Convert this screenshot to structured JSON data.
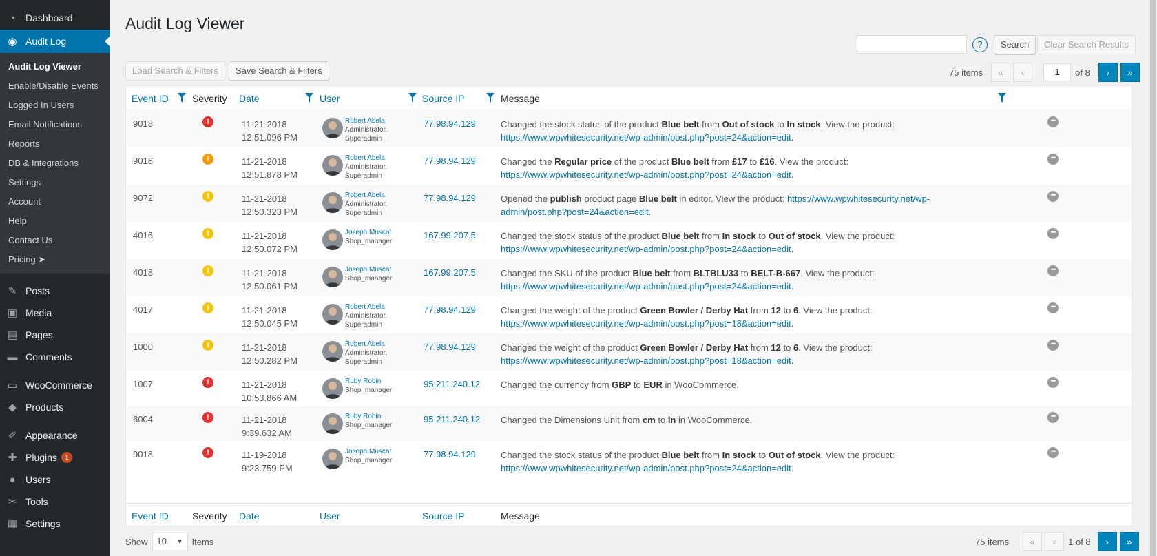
{
  "sidebar": {
    "top": [
      {
        "label": "Dashboard",
        "icon": "dashboard-icon",
        "glyph": "◔"
      },
      {
        "label": "Audit Log",
        "icon": "audit-log-icon",
        "glyph": "◉"
      }
    ],
    "submenu": [
      "Audit Log Viewer",
      "Enable/Disable Events",
      "Logged In Users",
      "Email Notifications",
      "Reports",
      "DB & Integrations",
      "Settings",
      "Account",
      "Help",
      "Contact Us",
      "Pricing ➤"
    ],
    "group1": [
      {
        "label": "Posts",
        "icon": "pin-icon",
        "glyph": "✎"
      },
      {
        "label": "Media",
        "icon": "media-icon",
        "glyph": "▣"
      },
      {
        "label": "Pages",
        "icon": "pages-icon",
        "glyph": "▤"
      },
      {
        "label": "Comments",
        "icon": "comments-icon",
        "glyph": "▬"
      }
    ],
    "group2": [
      {
        "label": "WooCommerce",
        "icon": "woocommerce-icon",
        "glyph": "▭"
      },
      {
        "label": "Products",
        "icon": "products-icon",
        "glyph": "◆"
      }
    ],
    "group3": [
      {
        "label": "Appearance",
        "icon": "appearance-icon",
        "glyph": "✐"
      },
      {
        "label": "Plugins",
        "icon": "plugins-icon",
        "glyph": "✚",
        "badge": "1"
      },
      {
        "label": "Users",
        "icon": "users-icon",
        "glyph": "●"
      },
      {
        "label": "Tools",
        "icon": "tools-icon",
        "glyph": "✂"
      },
      {
        "label": "Settings",
        "icon": "settings-icon",
        "glyph": "▦"
      }
    ]
  },
  "page": {
    "title": "Audit Log Viewer",
    "search_btn": "Search",
    "clear_btn": "Clear Search Results",
    "load_btn": "Load Search & Filters",
    "save_btn": "Save Search & Filters",
    "help": "?"
  },
  "pager_top": {
    "items": "75 items",
    "first": "«",
    "prev": "‹",
    "current": "1",
    "of": "of 8",
    "next": "›",
    "last": "»"
  },
  "pager_bottom": {
    "items": "75 items",
    "first": "«",
    "prev": "‹",
    "of": "1 of 8",
    "next": "›",
    "last": "»"
  },
  "footer": {
    "show": "Show",
    "per_page": "10",
    "items": "Items"
  },
  "columns": {
    "event_id": "Event ID",
    "severity": "Severity",
    "date": "Date",
    "user": "User",
    "source_ip": "Source IP",
    "message": "Message"
  },
  "rows": [
    {
      "id": "9018",
      "sev": "critical",
      "sev_glyph": "!",
      "date1": "11-21-2018",
      "date2": "12:51.096 PM",
      "user": "Robert Abela",
      "role1": "Administrator,",
      "role2": "Superadmin",
      "ip": "77.98.94.129",
      "msg": "Changed the stock status of the product <b>Blue belt</b> from <b>Out of stock</b> to <b>In stock</b>. View the product: <a>https://www.wpwhitesecurity.net/wp-admin/post.php?post=24&amp;action=edit</a>."
    },
    {
      "id": "9016",
      "sev": "high",
      "sev_glyph": "!",
      "date1": "11-21-2018",
      "date2": "12:51.878 PM",
      "user": "Robert Abela",
      "role1": "Administrator,",
      "role2": "Superadmin",
      "ip": "77.98.94.129",
      "msg": "Changed the <b>Regular price</b> of the product <b>Blue belt</b> from <b>£17</b> to <b>£16</b>. View the product: <a>https://www.wpwhitesecurity.net/wp-admin/post.php?post=24&amp;action=edit</a>."
    },
    {
      "id": "9072",
      "sev": "low",
      "sev_glyph": "i",
      "date1": "11-21-2018",
      "date2": "12:50.323 PM",
      "user": "Robert Abela",
      "role1": "Administrator,",
      "role2": "Superadmin",
      "ip": "77.98.94.129",
      "msg": "Opened the <b>publish</b> product page <b>Blue belt</b> in editor. View the product: <a>https://www.wpwhitesecurity.net/wp-admin/post.php?post=24&amp;action=edit</a>."
    },
    {
      "id": "4016",
      "sev": "low",
      "sev_glyph": "i",
      "date1": "11-21-2018",
      "date2": "12:50.072 PM",
      "user": "Joseph Muscat",
      "role1": "Shop_manager",
      "role2": "",
      "ip": "167.99.207.5",
      "msg": "Changed the stock status of the product <b>Blue belt</b> from <b>In stock</b> to <b>Out of stock</b>. View the product: <a>https://www.wpwhitesecurity.net/wp-admin/post.php?post=24&amp;action=edit</a>."
    },
    {
      "id": "4018",
      "sev": "low",
      "sev_glyph": "i",
      "date1": "11-21-2018",
      "date2": "12:50.061 PM",
      "user": "Joseph Muscat",
      "role1": "Shop_manager",
      "role2": "",
      "ip": "167.99.207.5",
      "msg": "Changed the SKU of the product <b>Blue belt</b> from <b>BLTBLU33</b> to <b>BELT-B-667</b>. View the product: <a>https://www.wpwhitesecurity.net/wp-admin/post.php?post=24&amp;action=edit</a>."
    },
    {
      "id": "4017",
      "sev": "low",
      "sev_glyph": "i",
      "date1": "11-21-2018",
      "date2": "12:50.045 PM",
      "user": "Robert Abela",
      "role1": "Administrator,",
      "role2": "Superadmin",
      "ip": "77.98.94.129",
      "msg": "Changed the weight of the product <b>Green Bowler / Derby Hat</b> from <b>12</b> to <b>6</b>. View the product: <a>https://www.wpwhitesecurity.net/wp-admin/post.php?post=18&amp;action=edit</a>."
    },
    {
      "id": "1000",
      "sev": "low",
      "sev_glyph": "i",
      "date1": "11-21-2018",
      "date2": "12:50.282 PM",
      "user": "Robert Abela",
      "role1": "Administrator,",
      "role2": "Superadmin",
      "ip": "77.98.94.129",
      "msg": "Changed the weight of the product <b>Green Bowler / Derby Hat</b> from <b>12</b> to <b>6</b>. View the product: <a>https://www.wpwhitesecurity.net/wp-admin/post.php?post=18&amp;action=edit</a>."
    },
    {
      "id": "1007",
      "sev": "critical",
      "sev_glyph": "!",
      "date1": "11-21-2018",
      "date2": "10:53.866 AM",
      "user": "Ruby Robin",
      "role1": "Shop_manager",
      "role2": "",
      "ip": "95.211.240.12",
      "msg": "Changed the currency from <b>GBP</b> to <b>EUR</b> in WooCommerce."
    },
    {
      "id": "6004",
      "sev": "critical",
      "sev_glyph": "!",
      "date1": "11-21-2018",
      "date2": "9:39.632 AM",
      "user": "Ruby Robin",
      "role1": "Shop_manager",
      "role2": "",
      "ip": "95.211.240.12",
      "msg": "Changed the Dimensions Unit from <b>cm</b> to <b>in</b> in WooCommerce."
    },
    {
      "id": "9018",
      "sev": "critical",
      "sev_glyph": "!",
      "date1": "11-19-2018",
      "date2": "9:23.759 PM",
      "user": "Joseph Muscat",
      "role1": "Shop_manager",
      "role2": "",
      "ip": "77.98.94.129",
      "msg": "Changed the stock status of the product <b>Blue belt</b> from <b>In stock</b> to <b>Out of stock</b>. View the product: <a>https://www.wpwhitesecurity.net/wp-admin/post.php?post=24&amp;action=edit</a>."
    }
  ],
  "colors": {
    "sidebar": "#23282d",
    "accent": "#0073aa",
    "critical": "#dc3232",
    "high": "#f39c12",
    "low": "#f1c40f"
  }
}
